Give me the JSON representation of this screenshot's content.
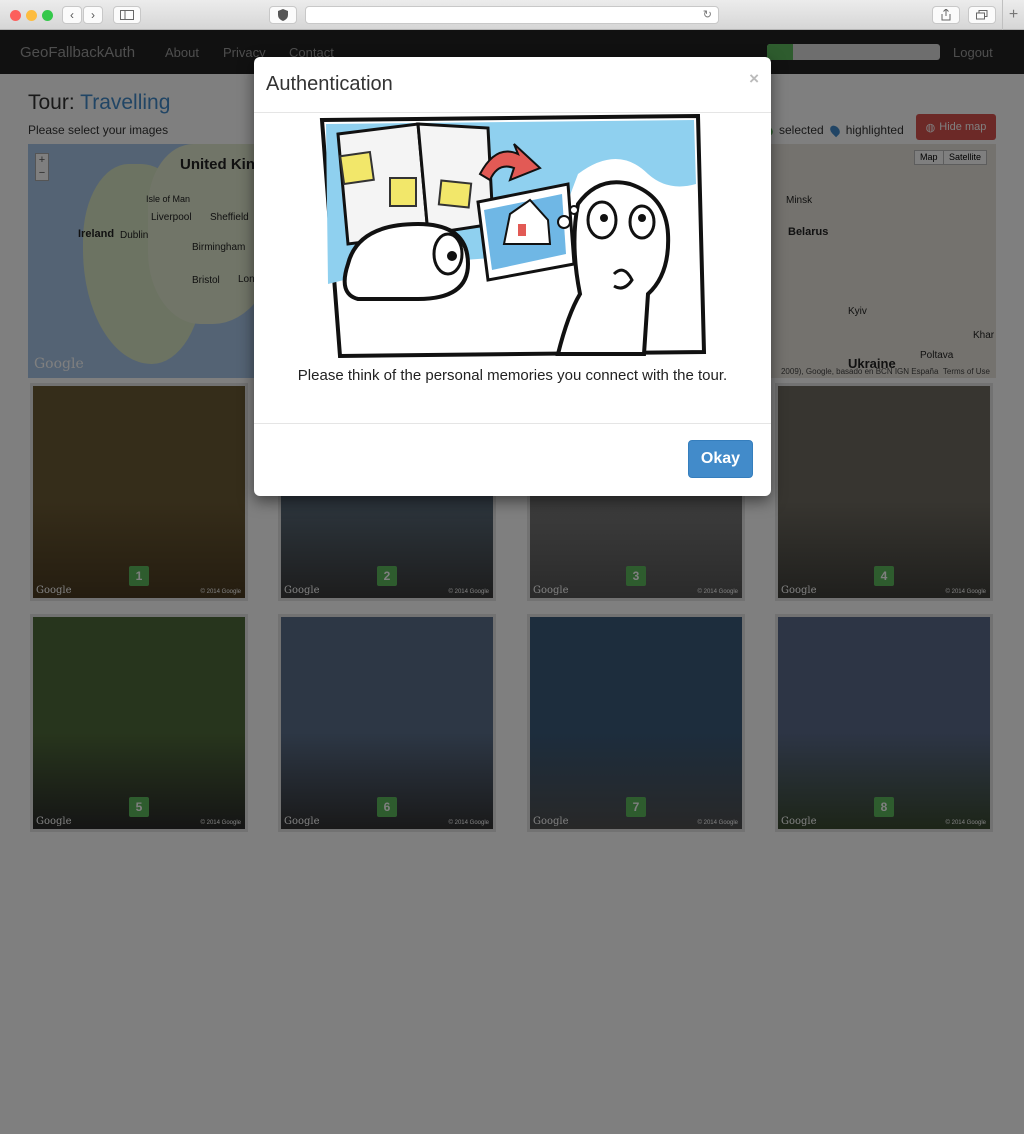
{
  "browser": {
    "reload_glyph": "↻",
    "new_tab_glyph": "+"
  },
  "navbar": {
    "brand": "GeoFallbackAuth",
    "links": [
      "About",
      "Privacy",
      "Contact"
    ],
    "progress_fraction": 0.15,
    "logout": "Logout",
    "progress_color": "#5cb85c"
  },
  "page": {
    "title_prefix": "Tour:",
    "tour_name": "Travelling",
    "subtitle": "Please select your images",
    "legend": {
      "selected": "selected",
      "highlighted": "highlighted"
    },
    "hide_map_label": "Hide map"
  },
  "map": {
    "labels": {
      "uk": "United Kingdom",
      "isle_of_man": "Isle of Man",
      "liverpool": "Liverpool",
      "sheffield": "Sheffield",
      "ireland": "Ireland",
      "dublin": "Dublin",
      "birmingham": "Birmingham",
      "bristol": "Bristol",
      "lon": "Lon",
      "minsk": "Minsk",
      "belarus": "Belarus",
      "kyiv": "Kyiv",
      "poltava": "Poltava",
      "khar": "Khar",
      "ukraine": "Ukraine"
    },
    "zoom_in": "+",
    "zoom_out": "−",
    "type_map": "Map",
    "type_satellite": "Satellite",
    "google": "Google",
    "credit": "2009), Google, basado en BCN IGN España",
    "terms": "Terms of Use"
  },
  "images": [
    {
      "number": "1",
      "color_top": "#6b5a34",
      "color_bottom": "#4a3a20"
    },
    {
      "number": "2",
      "color_top": "#5a6b7a",
      "color_bottom": "#3a3a3a"
    },
    {
      "number": "3",
      "color_top": "#7a7a7a",
      "color_bottom": "#555555"
    },
    {
      "number": "4",
      "color_top": "#6e6a60",
      "color_bottom": "#3f3f3a"
    },
    {
      "number": "5",
      "color_top": "#4f6a3a",
      "color_bottom": "#2a2a2a"
    },
    {
      "number": "6",
      "color_top": "#5a6e8a",
      "color_bottom": "#333333"
    },
    {
      "number": "7",
      "color_top": "#3a5a7a",
      "color_bottom": "#505050"
    },
    {
      "number": "8",
      "color_top": "#5a6a8a",
      "color_bottom": "#3a4a30"
    }
  ],
  "thumb_google": "Google",
  "thumb_copyright": "© 2014 Google",
  "modal": {
    "title": "Authentication",
    "close": "×",
    "message": "Please think of the personal memories you connect with the tour.",
    "ok_button": "Okay"
  }
}
